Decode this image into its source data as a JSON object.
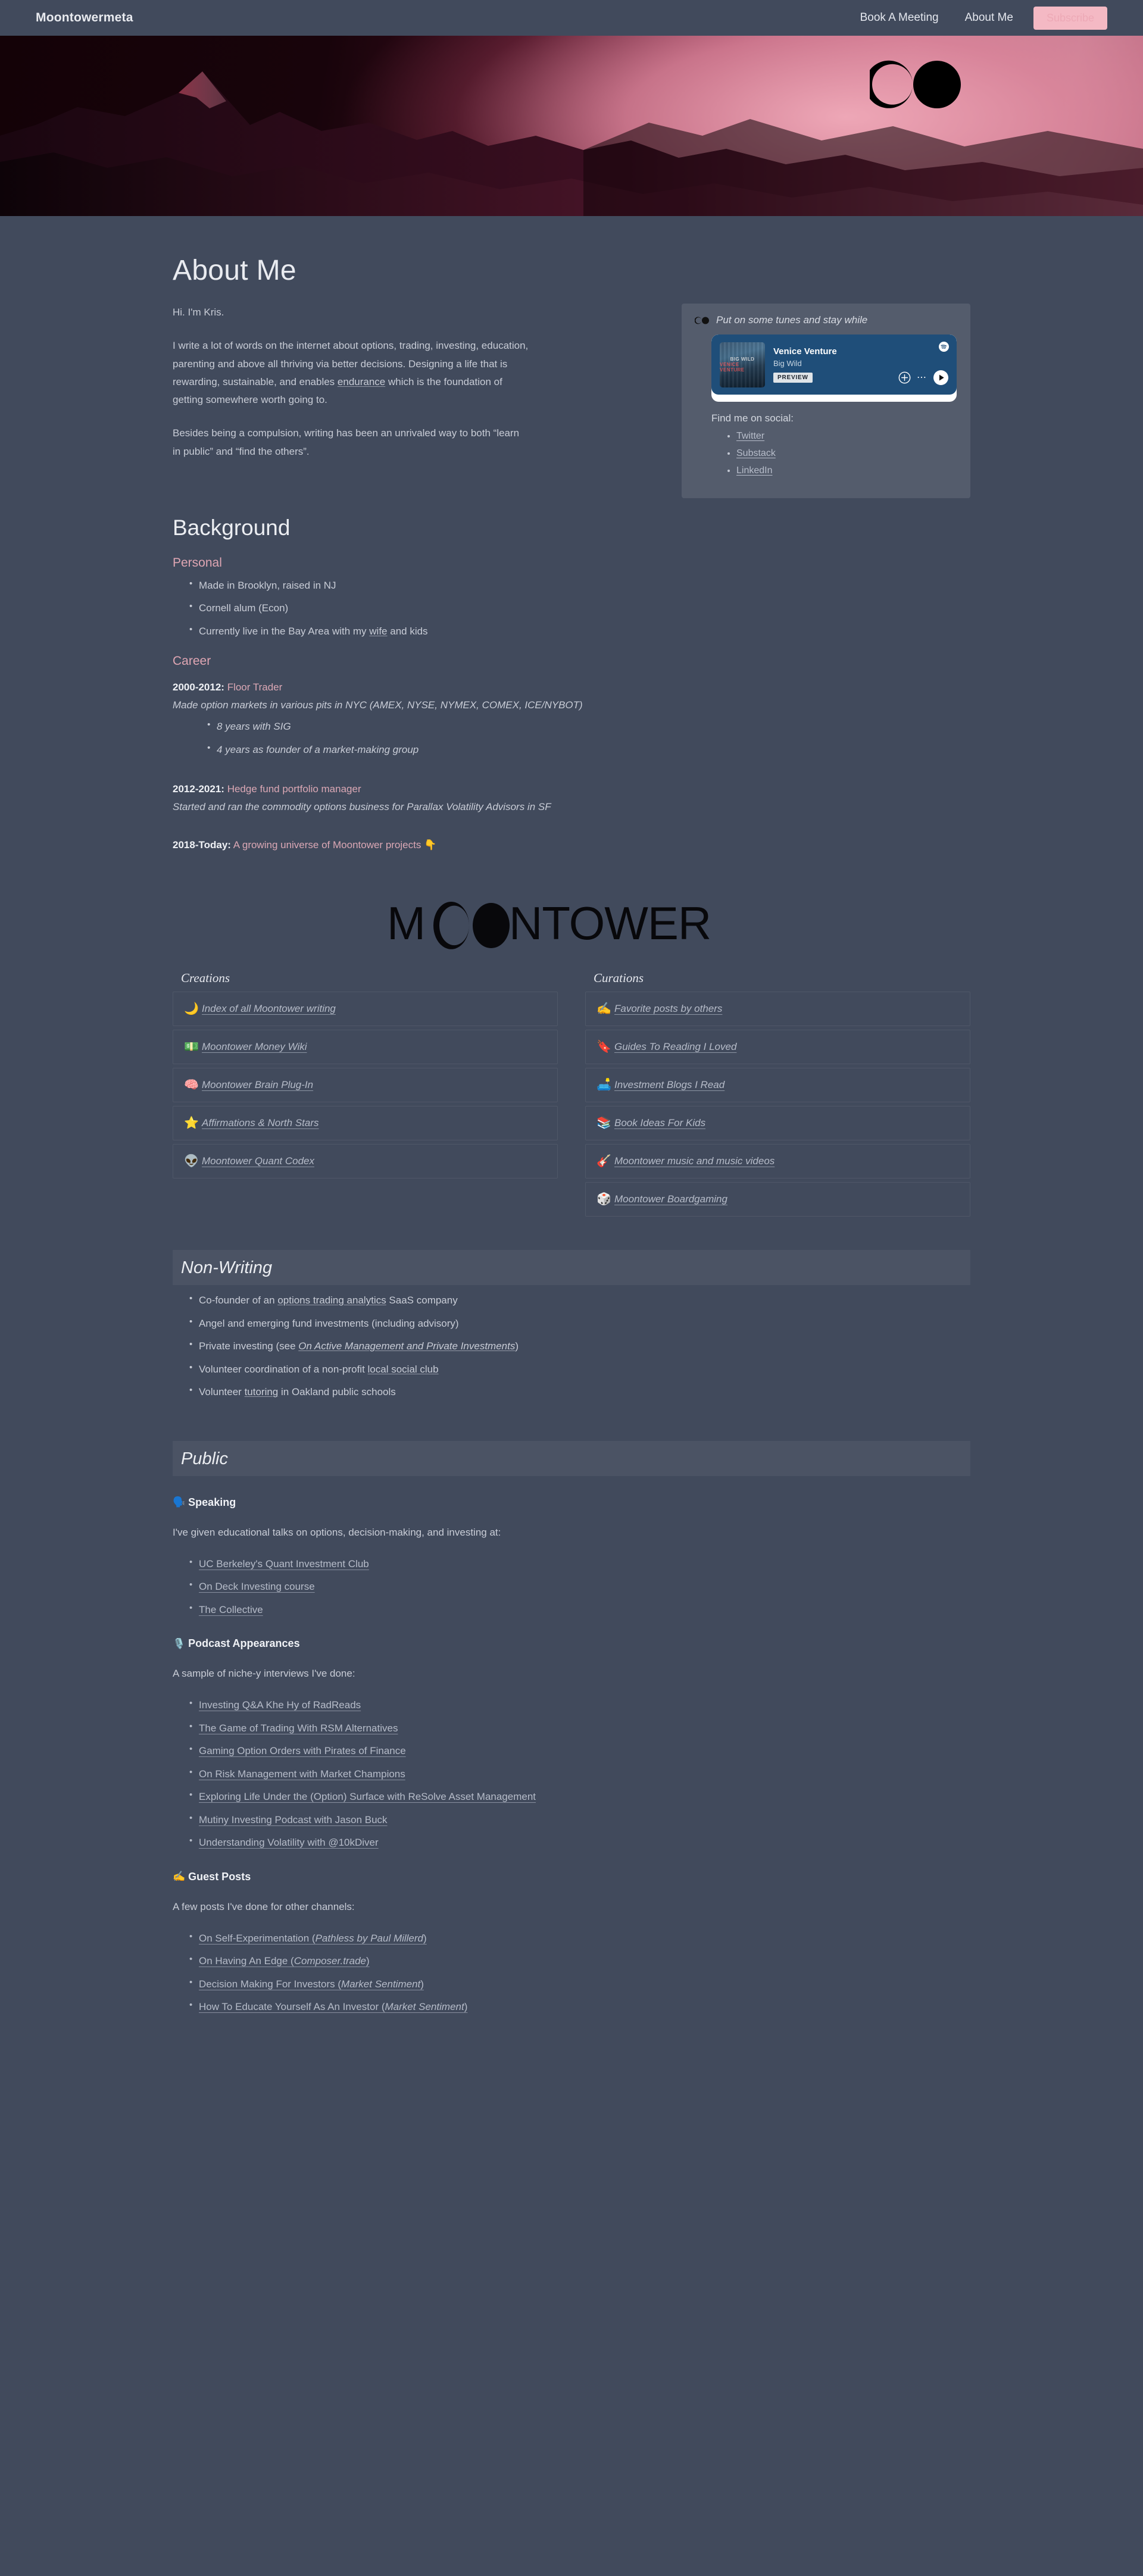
{
  "nav": {
    "brand": "Moontowermeta",
    "links": [
      {
        "label": "Book A Meeting"
      },
      {
        "label": "About Me"
      }
    ],
    "subscribe_label": "Subscribe",
    "subscribe_color": "#f4b9c4"
  },
  "hero": {
    "logo_name": "moontower-eclipse-logo"
  },
  "page": {
    "title": "About Me",
    "greeting": "Hi. I'm Kris.",
    "para1_a": "I write a lot of words on the internet about options, trading, investing, education, parenting and above all thriving via better decisions. Designing a life that is rewarding, sustainable, and enables ",
    "para1_link": "endurance",
    "para1_b": " which is the foundation of getting somewhere worth going to.",
    "para2": "Besides being a compulsion, writing has been an unrivaled way to both “learn in public” and “find the others”."
  },
  "tunes": {
    "heading": "Put on some tunes and stay while",
    "spotify": {
      "title": "Venice Venture",
      "artist": "Big Wild",
      "preview_label": "PREVIEW",
      "art_line1": "BIG WILD",
      "art_line2": "VENICE VENTURE",
      "accent": "#1f4e79"
    },
    "social_label": "Find me on social:",
    "social": [
      {
        "label": "Twitter"
      },
      {
        "label": "Substack"
      },
      {
        "label": "LinkedIn"
      }
    ]
  },
  "background": {
    "title": "Background",
    "personal_head": "Personal",
    "personal": [
      {
        "text_a": "Made in Brooklyn, raised in NJ",
        "link": "",
        "text_b": ""
      },
      {
        "text_a": "Cornell alum (Econ)",
        "link": "",
        "text_b": ""
      },
      {
        "text_a": "Currently live in the Bay Area with my ",
        "link": "wife",
        "text_b": " and kids"
      }
    ],
    "career_head": "Career",
    "roles": [
      {
        "years": "2000-2012:",
        "title": " Floor Trader",
        "desc": "Made option markets in various pits in NYC (AMEX, NYSE, NYMEX, COMEX, ICE/NYBOT)",
        "bullets": [
          "8 years with SIG",
          "4 years as founder of a market-making group"
        ]
      },
      {
        "years": "2012-2021:",
        "title": " Hedge fund portfolio manager",
        "desc": "Started and ran the commodity options business for Parallax Volatility Advisors in SF",
        "bullets": []
      },
      {
        "years": "2018-Today:",
        "title": " A growing universe of Moontower projects 👇",
        "desc": "",
        "bullets": []
      }
    ]
  },
  "wordmark": {
    "text": "MOONTOWER"
  },
  "creations": {
    "heading": "Creations",
    "items": [
      {
        "emoji": "🌙",
        "icon_name": "crescent-moon-icon",
        "label": "Index of all Moontower writing"
      },
      {
        "emoji": "💵",
        "icon_name": "money-note-icon",
        "label": "Moontower Money Wiki"
      },
      {
        "emoji": "🧠",
        "icon_name": "brain-icon",
        "label": "Moontower Brain Plug-In"
      },
      {
        "emoji": "⭐",
        "icon_name": "star-icon",
        "label": "Affirmations & North Stars"
      },
      {
        "emoji": "👽",
        "icon_name": "alien-icon",
        "label": "Moontower Quant Codex"
      }
    ]
  },
  "curations": {
    "heading": "Curations",
    "items": [
      {
        "emoji": "✍️",
        "icon_name": "writing-hand-icon",
        "label": "Favorite posts by others"
      },
      {
        "emoji": "🔖",
        "icon_name": "bookmark-icon",
        "label": "Guides To Reading I Loved"
      },
      {
        "emoji": "🛋️",
        "icon_name": "couch-lamp-icon",
        "label": "Investment Blogs I Read"
      },
      {
        "emoji": "📚",
        "icon_name": "books-icon",
        "label": "Book Ideas For Kids"
      },
      {
        "emoji": "🎸",
        "icon_name": "guitar-icon",
        "label": "Moontower music and music videos"
      },
      {
        "emoji": "🎲",
        "icon_name": "game-die-icon",
        "label": "Moontower Boardgaming"
      }
    ]
  },
  "nonwriting": {
    "title": "Non-Writing",
    "items": [
      {
        "a": "Co-founder of an ",
        "link": "options trading analytics",
        "b": " SaaS company",
        "italic_link": false
      },
      {
        "a": "Angel and emerging fund investments (including advisory)",
        "link": "",
        "b": "",
        "italic_link": false
      },
      {
        "a": "Private investing (see ",
        "link": "On Active Management and Private Investments",
        "b": ")",
        "italic_link": true
      },
      {
        "a": "Volunteer coordination of a non-profit ",
        "link": "local social club",
        "b": "",
        "italic_link": false
      },
      {
        "a": "Volunteer ",
        "link": "tutoring",
        "b": " in Oakland public schools",
        "italic_link": false
      }
    ]
  },
  "public": {
    "title": "Public",
    "speaking": {
      "emoji": "🗣️",
      "icon_name": "speaking-head-icon",
      "heading": "Speaking",
      "lead": "I've given educational talks on options, decision-making, and investing at:",
      "items": [
        {
          "label": "UC Berkeley's Quant Investment Club"
        },
        {
          "label": "On Deck Investing course"
        },
        {
          "label": "The Collective"
        }
      ]
    },
    "podcasts": {
      "emoji": "🎙️",
      "icon_name": "microphone-icon",
      "heading": "Podcast Appearances",
      "lead": "A sample of niche-y interviews I've done:",
      "items": [
        {
          "label": "Investing Q&A Khe Hy of RadReads"
        },
        {
          "label": "The Game of Trading With RSM Alternatives"
        },
        {
          "label": "Gaming Option Orders with Pirates of Finance"
        },
        {
          "label": "On Risk Management with Market Champions"
        },
        {
          "label": "Exploring Life Under the (Option) Surface with ReSolve Asset Management"
        },
        {
          "label": "Mutiny Investing Podcast with Jason Buck"
        },
        {
          "label": "Understanding Volatility with @10kDiver"
        }
      ]
    },
    "guest": {
      "emoji": "✍️",
      "icon_name": "writing-hand-icon",
      "heading": "Guest Posts",
      "lead": "A few posts I've done for other channels:",
      "items": [
        {
          "a": "On Self-Experimentation (",
          "i": "Pathless by Paul Millerd",
          "b": ")"
        },
        {
          "a": "On Having An Edge (",
          "i": "Composer.trade",
          "b": ")"
        },
        {
          "a": "Decision Making For Investors (",
          "i": "Market Sentiment",
          "b": ")"
        },
        {
          "a": "How To Educate Yourself As An Investor (",
          "i": "Market Sentiment",
          "b": ")"
        }
      ]
    }
  }
}
